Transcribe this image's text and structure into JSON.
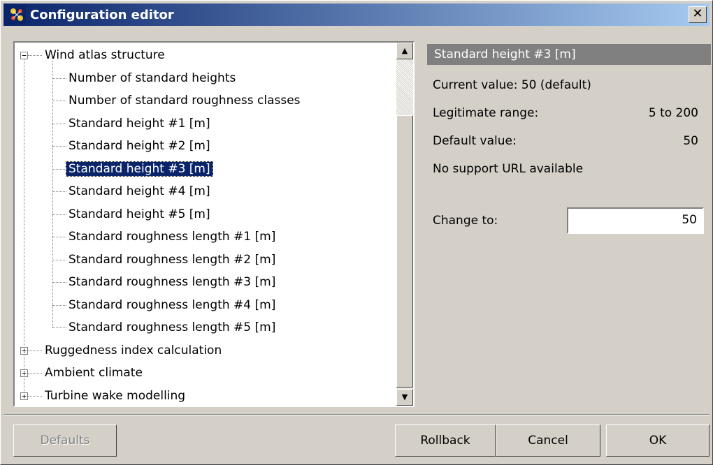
{
  "window": {
    "title": "Configuration editor",
    "close_label": "✕",
    "title_gradient_start": "#0a246a",
    "title_gradient_end": "#a6caf0"
  },
  "tree": {
    "root": {
      "label": "Wind atlas structure",
      "expanded": true,
      "expander": "−",
      "children": [
        "Number of standard heights",
        "Number of standard roughness classes",
        "Standard height #1 [m]",
        "Standard height #2 [m]",
        "Standard height #3 [m]",
        "Standard height #4 [m]",
        "Standard height #5 [m]",
        "Standard roughness length #1 [m]",
        "Standard roughness length #2 [m]",
        "Standard roughness length #3 [m]",
        "Standard roughness length #4 [m]",
        "Standard roughness length #5 [m]"
      ],
      "selected_index": 4
    },
    "collapsed_groups": [
      {
        "label": "Ruggedness index calculation",
        "expander": "+"
      },
      {
        "label": "Ambient climate",
        "expander": "+"
      },
      {
        "label": "Turbine wake modelling",
        "expander": "+"
      }
    ]
  },
  "scrollbar": {
    "up_arrow": "▲",
    "down_arrow": "▼"
  },
  "detail": {
    "header": "Standard height #3 [m]",
    "current_value": "Current value: 50 (default)",
    "range_label": "Legitimate range:",
    "range_value": "5 to 200",
    "default_label": "Default value:",
    "default_value": "50",
    "support_url": "No support URL available",
    "change_label": "Change to:",
    "change_value": "50"
  },
  "buttons": {
    "defaults": "Defaults",
    "rollback": "Rollback",
    "cancel": "Cancel",
    "ok": "OK"
  }
}
